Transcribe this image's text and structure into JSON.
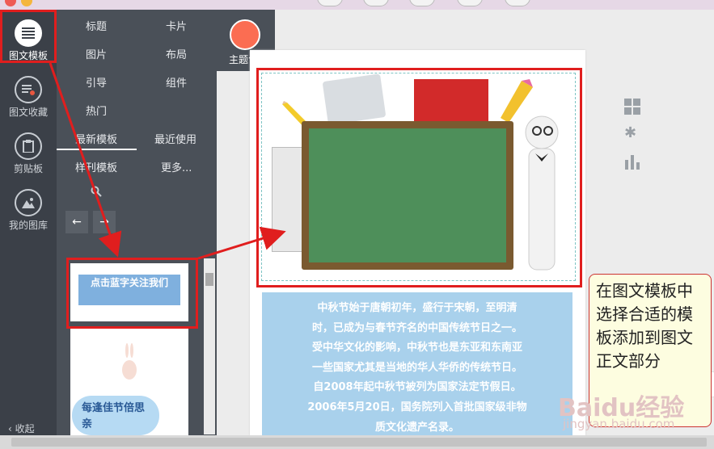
{
  "rail": {
    "items": [
      {
        "label": "图文模板",
        "icon": "list-icon"
      },
      {
        "label": "图文收藏",
        "icon": "bookmark-list-icon"
      },
      {
        "label": "剪贴板",
        "icon": "clipboard-icon"
      },
      {
        "label": "我的图库",
        "icon": "image-library-icon"
      }
    ],
    "collapse_label": "收起"
  },
  "panel": {
    "categories": [
      {
        "label": "标题"
      },
      {
        "label": "卡片"
      },
      {
        "label": "图片"
      },
      {
        "label": "布局"
      },
      {
        "label": "引导"
      },
      {
        "label": "组件"
      },
      {
        "label": "热门"
      }
    ],
    "tabs": [
      {
        "label": "最新模板"
      },
      {
        "label": "最近使用"
      },
      {
        "label": "样刊模板"
      },
      {
        "label": "更多..."
      }
    ],
    "theme_label": "主题色",
    "theme_color": "#fb6d52"
  },
  "templates": [
    {
      "text": "点击蓝字关注我们"
    },
    {
      "text": "每逢佳节倍思亲"
    }
  ],
  "editor": {
    "body_lines": [
      "中秋节始于唐朝初年，盛行于宋朝，至明清",
      "时，已成为与春节齐名的中国传统节日之一。",
      "受中华文化的影响，中秋节也是东亚和东南亚",
      "一些国家尤其是当地的华人华侨的传统节日。",
      "自2008年起中秋节被列为国家法定节假日。",
      "2006年5月20日，国务院列入首批国家级非物",
      "质文化遗产名录。"
    ]
  },
  "annotation": {
    "note": "在图文模板中选择合适的模板添加到图文正文部分"
  },
  "watermark": {
    "brand": "Baidu经验",
    "url": "jingyan.baidu.com"
  },
  "colors": {
    "annotation_red": "#e01e1e",
    "rail_bg": "#3b4048",
    "panel_bg": "#4a5058"
  }
}
